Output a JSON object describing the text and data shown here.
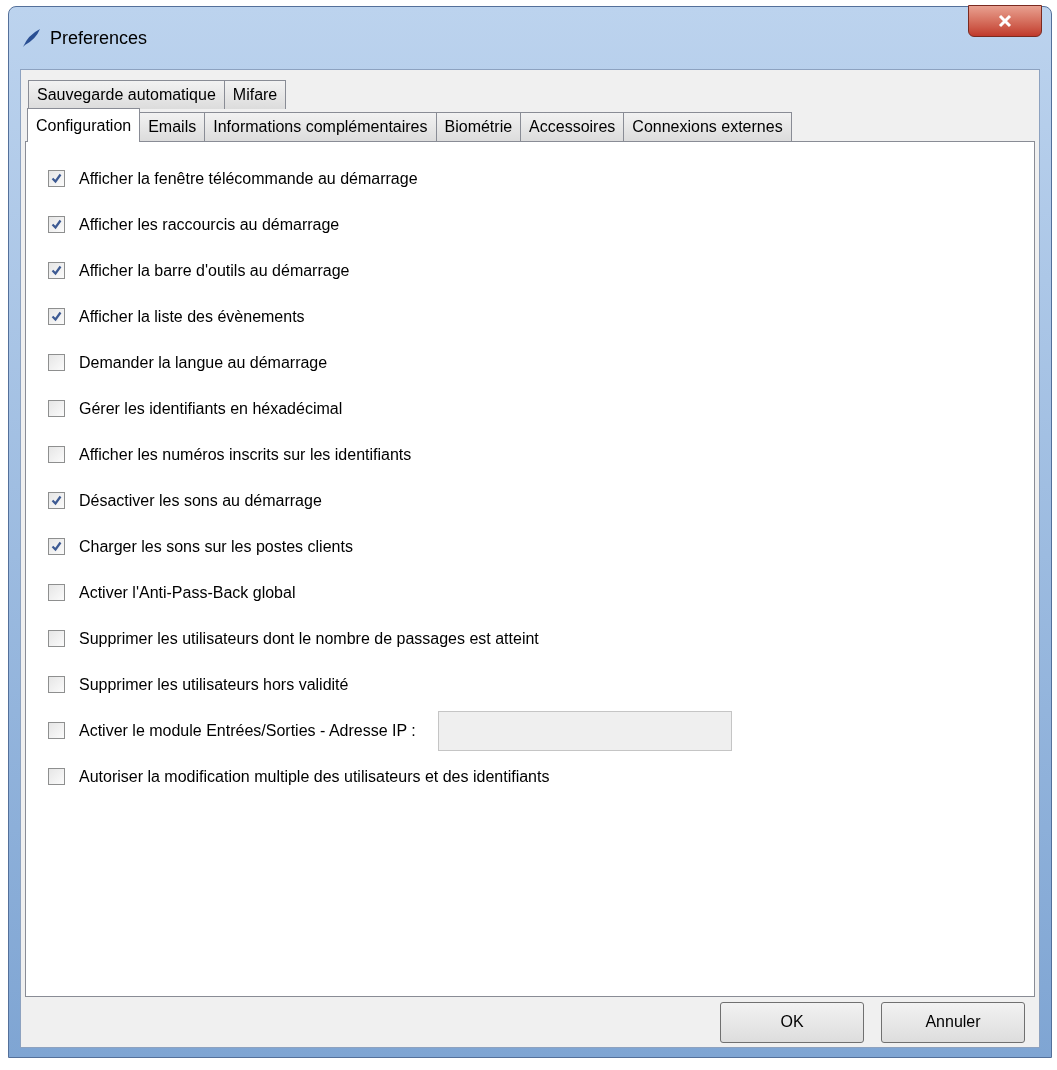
{
  "window": {
    "title": "Preferences"
  },
  "tab_rows": [
    [
      {
        "label": "Sauvegarde automatique",
        "selected": false
      },
      {
        "label": "Mifare",
        "selected": false
      }
    ],
    [
      {
        "label": "Configuration",
        "selected": true
      },
      {
        "label": "Emails",
        "selected": false
      },
      {
        "label": "Informations complémentaires",
        "selected": false
      },
      {
        "label": "Biométrie",
        "selected": false
      },
      {
        "label": "Accessoires",
        "selected": false
      },
      {
        "label": "Connexions externes",
        "selected": false
      }
    ]
  ],
  "options": [
    {
      "kind": "checkbox",
      "label": "Afficher la fenêtre télécommande au démarrage",
      "checked": true
    },
    {
      "kind": "checkbox",
      "label": "Afficher les raccourcis au démarrage",
      "checked": true
    },
    {
      "kind": "checkbox",
      "label": "Afficher la barre d'outils au démarrage",
      "checked": true
    },
    {
      "kind": "checkbox",
      "label": "Afficher la liste des évènements",
      "checked": true
    },
    {
      "kind": "checkbox",
      "label": "Demander la langue au démarrage",
      "checked": false
    },
    {
      "kind": "checkbox",
      "label": "Gérer les identifiants en héxadécimal",
      "checked": false
    },
    {
      "kind": "checkbox",
      "label": "Afficher les numéros inscrits sur les identifiants",
      "checked": false
    },
    {
      "kind": "checkbox",
      "label": "Désactiver les sons au démarrage",
      "checked": true
    },
    {
      "kind": "checkbox",
      "label": "Charger les sons sur les postes clients",
      "checked": true
    },
    {
      "kind": "checkbox",
      "label": "Activer l'Anti-Pass-Back global",
      "checked": false
    },
    {
      "kind": "checkbox",
      "label": "Supprimer les utilisateurs dont le nombre de passages est atteint",
      "checked": false
    },
    {
      "kind": "checkbox",
      "label": "Supprimer les utilisateurs hors validité",
      "checked": false
    },
    {
      "kind": "checkbox_field",
      "label": "Activer le module Entrées/Sorties - Adresse IP :",
      "checked": false,
      "field_disabled": true
    },
    {
      "kind": "checkbox",
      "label": "Autoriser la modification multiple des utilisateurs et des identifiants",
      "checked": false
    }
  ],
  "buttons": [
    "OK",
    "Annuler"
  ]
}
